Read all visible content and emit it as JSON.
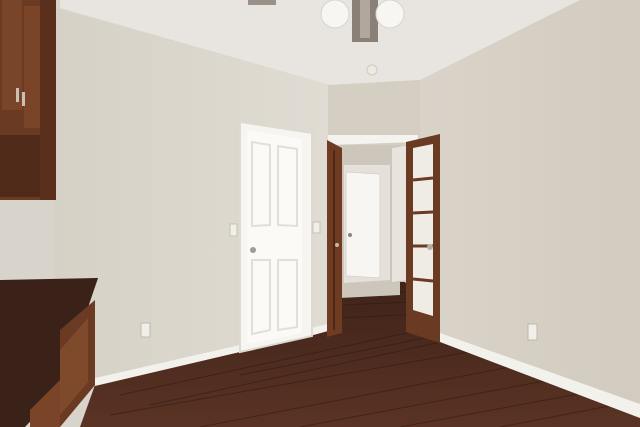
{
  "scene": {
    "colors": {
      "ceiling": "#e9e6e1",
      "left_wall": "#dcd7ce",
      "right_wall": "#d8d2c8",
      "back_wall": "#d6d0c4",
      "hall_wall": "#cfc8bc",
      "floor": "#4a2a1e",
      "floor_dark": "#3a2017",
      "trim": "#f3f1ec",
      "wood": "#6b3a22",
      "countertop": "#3b2218"
    }
  }
}
